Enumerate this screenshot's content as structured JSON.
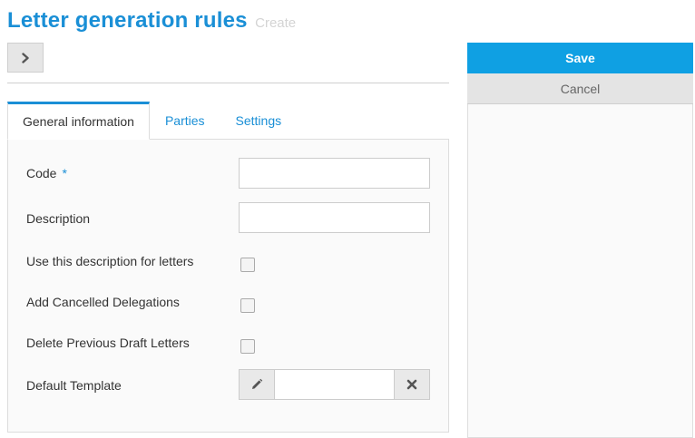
{
  "header": {
    "title": "Letter generation rules",
    "subtitle": "Create"
  },
  "toolbar": {
    "expand_icon": "chevron-right-icon"
  },
  "tabs": [
    {
      "label": "General information",
      "active": true
    },
    {
      "label": "Parties",
      "active": false
    },
    {
      "label": "Settings",
      "active": false
    }
  ],
  "form": {
    "code": {
      "label": "Code",
      "required_marker": "*",
      "value": ""
    },
    "description": {
      "label": "Description",
      "value": ""
    },
    "use_description": {
      "label": "Use this description for letters",
      "checked": false
    },
    "add_cancelled": {
      "label": "Add Cancelled Delegations",
      "checked": false
    },
    "delete_drafts": {
      "label": "Delete Previous Draft Letters",
      "checked": false
    },
    "default_template": {
      "label": "Default Template",
      "value": "",
      "edit_icon": "pencil-icon",
      "clear_icon": "close-icon"
    }
  },
  "actions": {
    "save_label": "Save",
    "cancel_label": "Cancel"
  },
  "colors": {
    "accent": "#1a8fd6",
    "save_bg": "#0fa0e3",
    "cancel_bg": "#e4e4e4"
  }
}
